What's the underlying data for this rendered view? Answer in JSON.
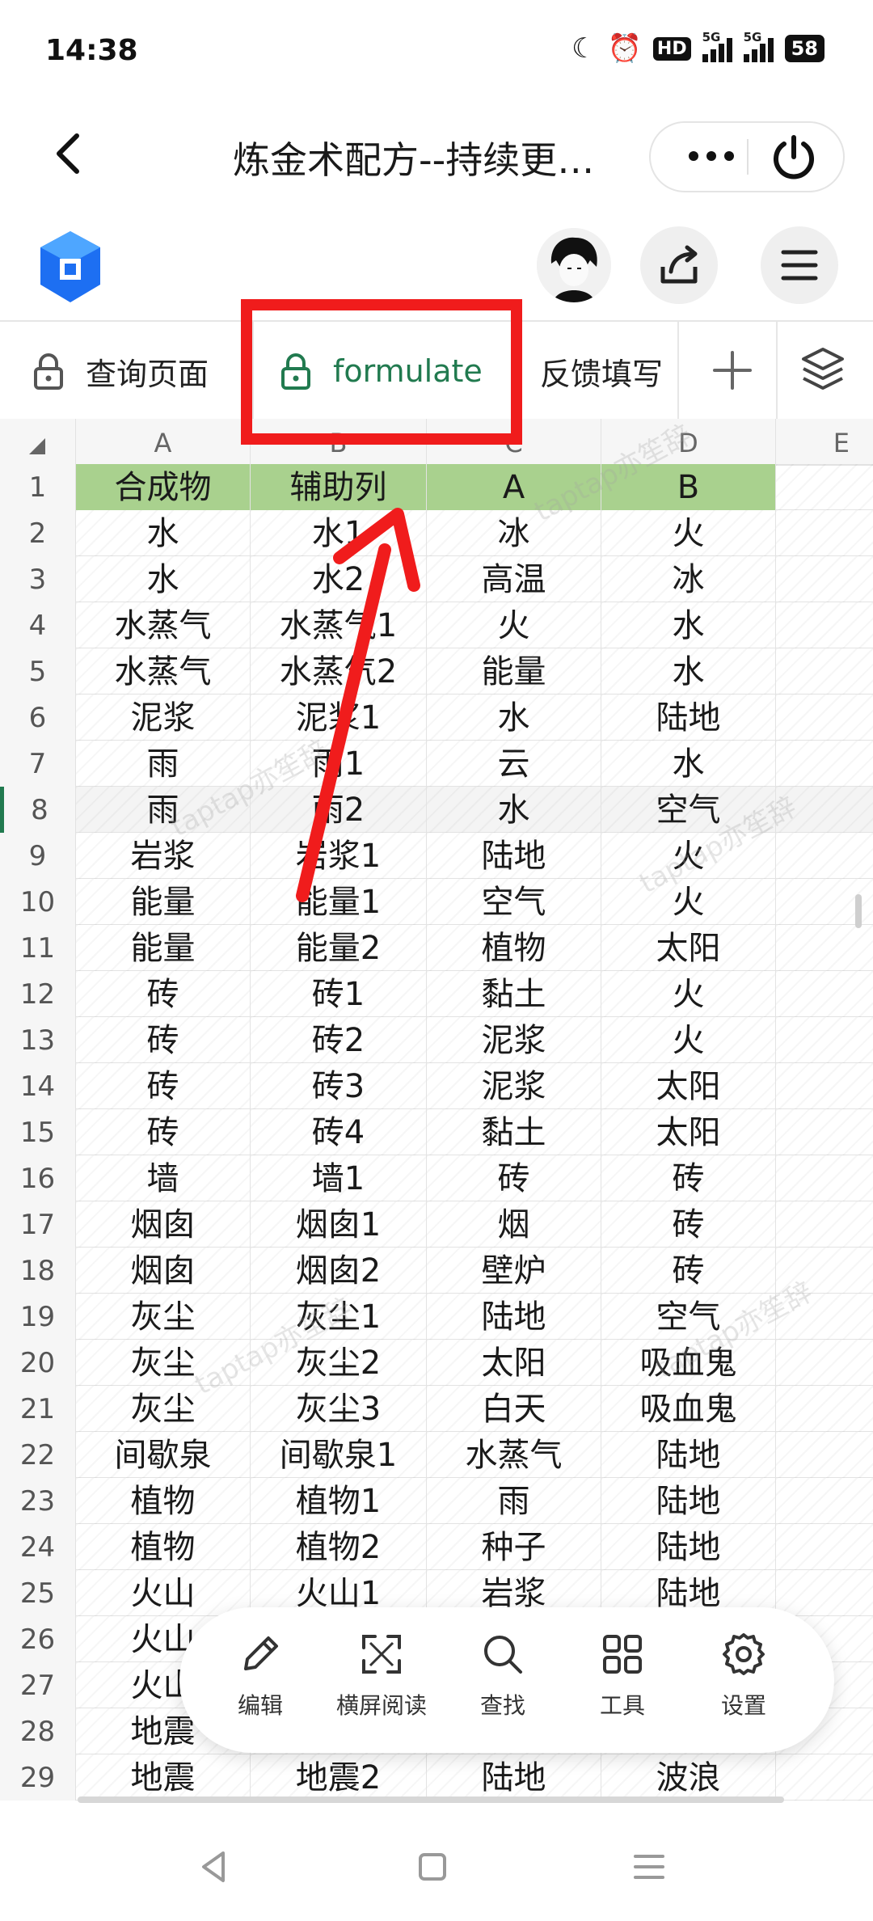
{
  "status_bar": {
    "time": "14:38",
    "hd_label": "HD",
    "net1": "5G",
    "net2": "5G",
    "battery": "58"
  },
  "title_bar": {
    "title": "炼金术配方--持续更…",
    "more_icon": "more-dots-icon",
    "power_icon": "power-icon"
  },
  "sheet_tabs": [
    {
      "label": "查询页面",
      "locked": true,
      "active": false
    },
    {
      "label": "formulate",
      "locked": true,
      "active": true
    },
    {
      "label": "反馈填写",
      "locked": false,
      "active": false
    }
  ],
  "columns": [
    "A",
    "B",
    "C",
    "D",
    "E"
  ],
  "rows": [
    {
      "n": "1",
      "cells": [
        "合成物",
        "辅助列",
        "A",
        "B"
      ]
    },
    {
      "n": "2",
      "cells": [
        "水",
        "水1",
        "冰",
        "火"
      ]
    },
    {
      "n": "3",
      "cells": [
        "水",
        "水2",
        "高温",
        "冰"
      ]
    },
    {
      "n": "4",
      "cells": [
        "水蒸气",
        "水蒸气1",
        "火",
        "水"
      ]
    },
    {
      "n": "5",
      "cells": [
        "水蒸气",
        "水蒸气2",
        "能量",
        "水"
      ]
    },
    {
      "n": "6",
      "cells": [
        "泥浆",
        "泥浆1",
        "水",
        "陆地"
      ]
    },
    {
      "n": "7",
      "cells": [
        "雨",
        "雨1",
        "云",
        "水"
      ]
    },
    {
      "n": "8",
      "cells": [
        "雨",
        "雨2",
        "水",
        "空气"
      ]
    },
    {
      "n": "9",
      "cells": [
        "岩浆",
        "岩浆1",
        "陆地",
        "火"
      ]
    },
    {
      "n": "10",
      "cells": [
        "能量",
        "能量1",
        "空气",
        "火"
      ]
    },
    {
      "n": "11",
      "cells": [
        "能量",
        "能量2",
        "植物",
        "太阳"
      ]
    },
    {
      "n": "12",
      "cells": [
        "砖",
        "砖1",
        "黏土",
        "火"
      ]
    },
    {
      "n": "13",
      "cells": [
        "砖",
        "砖2",
        "泥浆",
        "火"
      ]
    },
    {
      "n": "14",
      "cells": [
        "砖",
        "砖3",
        "泥浆",
        "太阳"
      ]
    },
    {
      "n": "15",
      "cells": [
        "砖",
        "砖4",
        "黏土",
        "太阳"
      ]
    },
    {
      "n": "16",
      "cells": [
        "墙",
        "墙1",
        "砖",
        "砖"
      ]
    },
    {
      "n": "17",
      "cells": [
        "烟囱",
        "烟囱1",
        "烟",
        "砖"
      ]
    },
    {
      "n": "18",
      "cells": [
        "烟囱",
        "烟囱2",
        "壁炉",
        "砖"
      ]
    },
    {
      "n": "19",
      "cells": [
        "灰尘",
        "灰尘1",
        "陆地",
        "空气"
      ]
    },
    {
      "n": "20",
      "cells": [
        "灰尘",
        "灰尘2",
        "太阳",
        "吸血鬼"
      ]
    },
    {
      "n": "21",
      "cells": [
        "灰尘",
        "灰尘3",
        "白天",
        "吸血鬼"
      ]
    },
    {
      "n": "22",
      "cells": [
        "间歇泉",
        "间歇泉1",
        "水蒸气",
        "陆地"
      ]
    },
    {
      "n": "23",
      "cells": [
        "植物",
        "植物1",
        "雨",
        "陆地"
      ]
    },
    {
      "n": "24",
      "cells": [
        "植物",
        "植物2",
        "种子",
        "陆地"
      ]
    },
    {
      "n": "25",
      "cells": [
        "火山",
        "火山1",
        "岩浆",
        "陆地"
      ]
    },
    {
      "n": "26",
      "cells": [
        "火山",
        "",
        "",
        ""
      ]
    },
    {
      "n": "27",
      "cells": [
        "火山",
        "",
        "",
        ""
      ]
    },
    {
      "n": "28",
      "cells": [
        "地震",
        "",
        "",
        ""
      ]
    },
    {
      "n": "29",
      "cells": [
        "地震",
        "地震2",
        "陆地",
        "波浪"
      ]
    }
  ],
  "selected_row": "8",
  "watermark_text": "taptap亦笙辞",
  "bottom_toolbar": [
    {
      "label": "编辑",
      "icon": "pencil-icon"
    },
    {
      "label": "横屏阅读",
      "icon": "fullscreen-icon"
    },
    {
      "label": "查找",
      "icon": "search-icon"
    },
    {
      "label": "工具",
      "icon": "grid-tools-icon"
    },
    {
      "label": "设置",
      "icon": "gear-icon"
    }
  ],
  "colors": {
    "header_fill": "#a9d18e",
    "active_tab": "#217a4f",
    "annotation": "#f01c1c"
  }
}
